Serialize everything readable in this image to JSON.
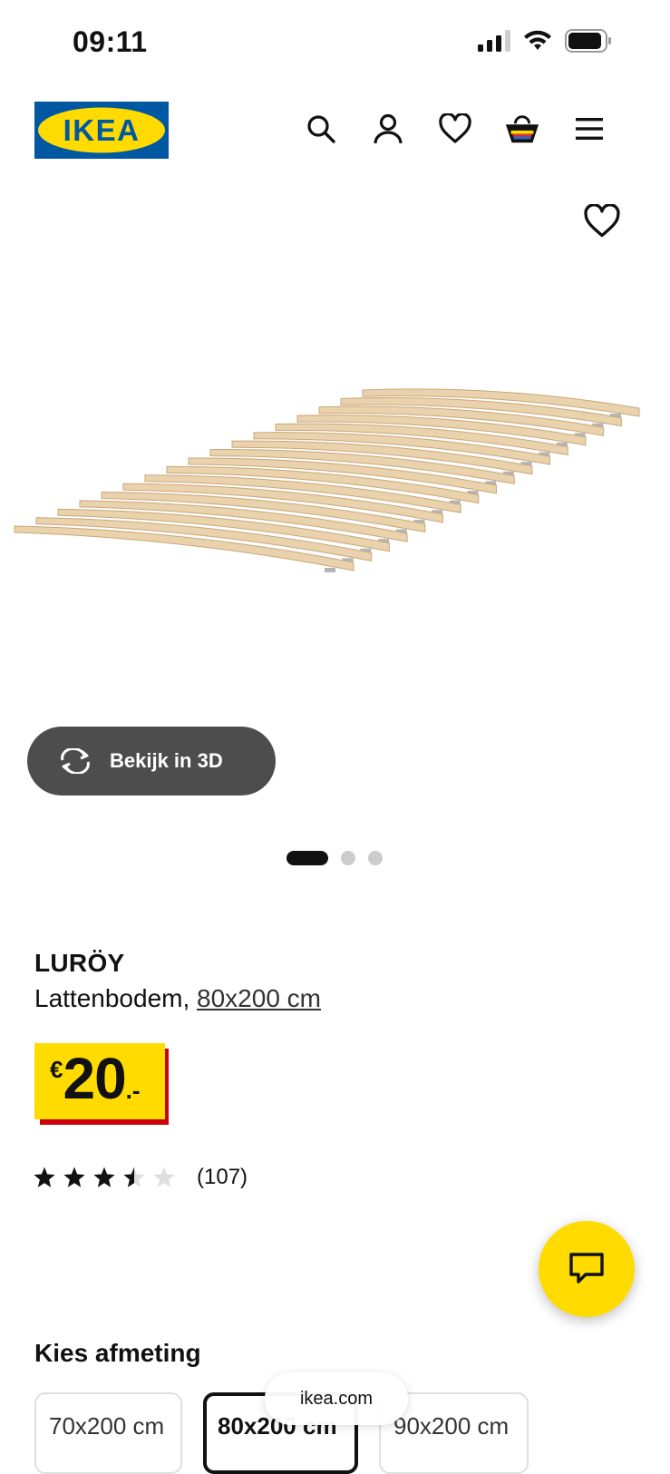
{
  "status_bar": {
    "time": "09:11"
  },
  "header": {
    "logo_text": "IKEA",
    "icons": [
      "search-icon",
      "account-icon",
      "wishlist-heart-icon",
      "shopping-bag-icon",
      "menu-icon"
    ]
  },
  "gallery": {
    "view_3d_label": "Bekijk in 3D",
    "slide_count": 3,
    "active_slide": 1
  },
  "product": {
    "name": "LURÖY",
    "type": "Lattenbodem,",
    "size_link": "80x200 cm",
    "price": {
      "currency": "€",
      "integer": "20",
      "decimal": ".-"
    },
    "rating": 3.5,
    "rating_max": 5,
    "review_count": "(107)"
  },
  "size_selector": {
    "heading": "Kies afmeting",
    "options": [
      "70x200 cm",
      "80x200 cm",
      "90x200 cm"
    ],
    "selected": "80x200 cm"
  },
  "browser": {
    "url": "ikea.com"
  },
  "colors": {
    "ikea_blue": "#0058a3",
    "ikea_yellow": "#ffdb00",
    "price_red": "#cc0008",
    "button_3d_bg": "#4d4d4d"
  }
}
